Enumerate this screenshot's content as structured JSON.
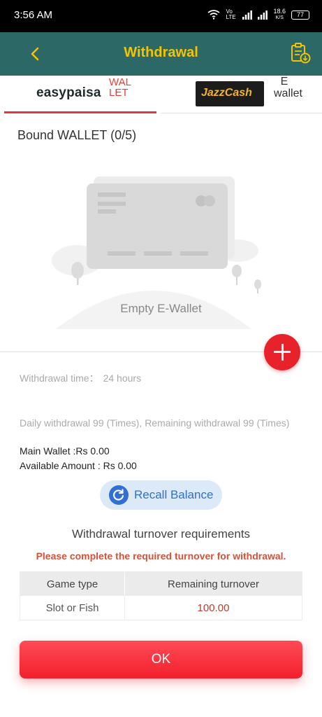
{
  "status_bar": {
    "time": "3:56 AM",
    "network_speed_value": "18.6",
    "network_speed_unit": "K/S",
    "battery": "77",
    "volte": "Vo LTE"
  },
  "header": {
    "title": "Withdrawal"
  },
  "tabs": [
    {
      "logo_text": "easypaisa",
      "label": "WALLET"
    },
    {
      "logo_text": "JazzCash",
      "label": "E wallet"
    }
  ],
  "wallet": {
    "title": "Bound WALLET (0/5)",
    "empty_text": "Empty E-Wallet"
  },
  "withdrawal_time": {
    "label": "Withdrawal time：",
    "value": "24 hours"
  },
  "daily_limit": "Daily withdrawal 99 (Times), Remaining withdrawal 99 (Times)",
  "main_wallet": "Main Wallet :Rs 0.00",
  "available_amount": "Available Amount : Rs 0.00",
  "recall_button": "Recall Balance",
  "turnover": {
    "title": "Withdrawal turnover requirements",
    "warning": "Please complete the required turnover for withdrawal.",
    "columns": [
      "Game type",
      "Remaining turnover"
    ],
    "rows": [
      {
        "game_type": "Slot or Fish",
        "remaining": "100.00"
      }
    ]
  },
  "ok_button": "OK",
  "colors": {
    "header_bg": "#2b6866",
    "title_yellow": "#f5c400",
    "accent_red": "#e8222a",
    "recall_blue": "#2f6fd6"
  }
}
